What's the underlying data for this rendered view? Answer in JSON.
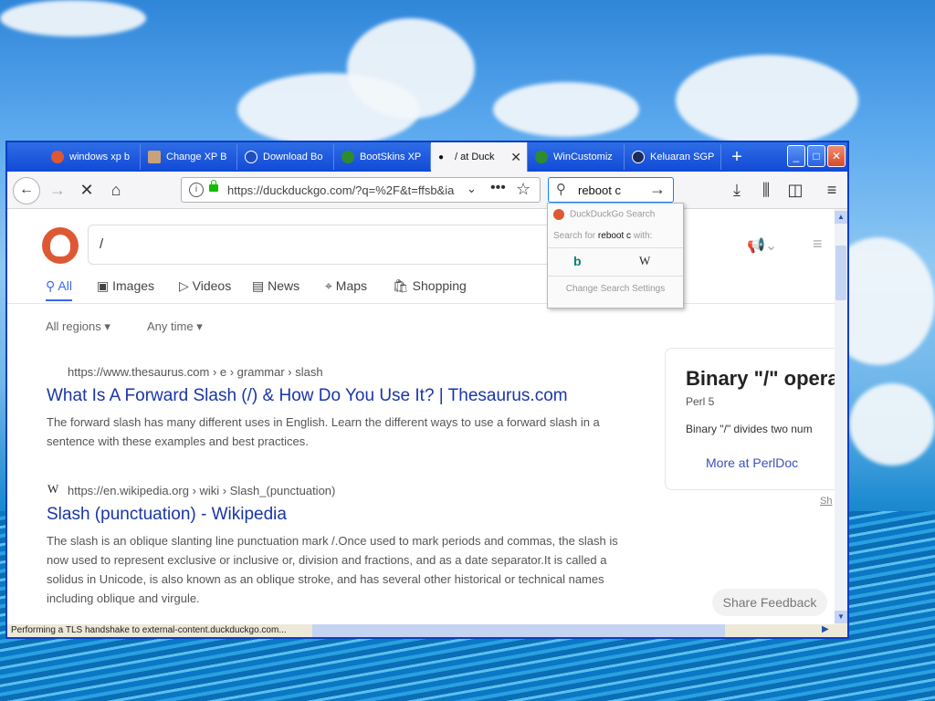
{
  "desktop": {
    "sky_color": "#5aa8ee",
    "sea_color": "#0b78c6"
  },
  "browser": {
    "tabs": [
      {
        "label": "windows xp b",
        "icon": "duckduckgo-icon"
      },
      {
        "label": "Change XP B",
        "icon": "avatar-icon"
      },
      {
        "label": "Download Bo",
        "icon": "download-icon"
      },
      {
        "label": "BootSkins XP",
        "icon": "leaf-icon"
      },
      {
        "label": "/ at Duck",
        "icon": "loading-dot-icon",
        "active": true
      },
      {
        "label": "WinCustomiz",
        "icon": "leaf-icon"
      },
      {
        "label": "Keluaran SGP",
        "icon": "wordpress-icon"
      }
    ],
    "new_tab_symbol": "+",
    "window_buttons": {
      "minimize": "_",
      "maximize": "□",
      "close": "✕"
    },
    "url": "https://duckduckgo.com/?q=%2F&t=ffsb&ia",
    "search_value": "reboot c",
    "status_text": "Performing a TLS handshake to external-content.duckduckgo.com..."
  },
  "search_dropdown": {
    "header": "DuckDuckGo Search",
    "search_for_prefix": "Search for",
    "search_for_term": "reboot c",
    "search_for_suffix": "with:",
    "engines": [
      "bing-icon",
      "wikipedia-icon"
    ],
    "settings_label": "Change Search Settings"
  },
  "ddg": {
    "query": "/",
    "tabs": [
      "All",
      "Images",
      "Videos",
      "News",
      "Maps",
      "Shopping"
    ],
    "filters": [
      "All regions",
      "Any time"
    ],
    "results": [
      {
        "url": "https://www.thesaurus.com › e › grammar › slash",
        "title": "What Is A Forward Slash (/) & How Do You Use It? | Thesaurus.com",
        "snippet": "The forward slash has many different uses in English. Learn the different ways to use a forward slash in a sentence with these examples and best practices."
      },
      {
        "url": "https://en.wikipedia.org › wiki › Slash_(punctuation)",
        "title": "Slash (punctuation) - Wikipedia",
        "snippet": "The slash is an oblique slanting line punctuation mark /.Once used to mark periods and commas, the slash is now used to represent exclusive or inclusive or, division and fractions, and as a date separator.It is called a solidus in Unicode, is also known as an oblique stroke, and has several other historical or technical names including oblique and virgule."
      }
    ],
    "panel": {
      "title": "Binary \"/\" opera",
      "subtitle": "Perl 5",
      "desc": "Binary \"/\" divides two num",
      "link": "More at PerlDoc"
    },
    "share_label": "Sh",
    "feedback_label": "Share Feedback"
  }
}
